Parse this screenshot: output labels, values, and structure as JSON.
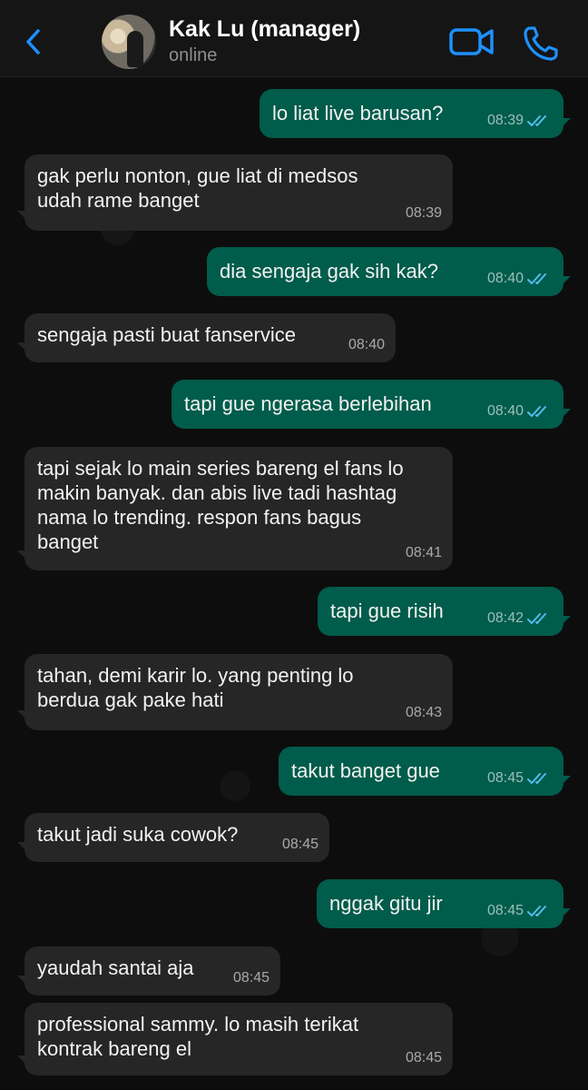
{
  "header": {
    "contact_name": "Kak Lu (manager)",
    "status": "online",
    "icons": [
      "chevron-left-icon",
      "video-call-icon",
      "phone-icon"
    ],
    "accent_color": "#1e90ff"
  },
  "messages": [
    {
      "dir": "out",
      "text": "lo liat live barusan?",
      "time": "08:39"
    },
    {
      "dir": "in",
      "text": "gak perlu nonton, gue liat di medsos\nudah rame banget",
      "time": "08:39"
    },
    {
      "dir": "out",
      "text": "dia sengaja gak sih kak?",
      "time": "08:40"
    },
    {
      "dir": "in",
      "text": "sengaja pasti buat fanservice",
      "time": "08:40"
    },
    {
      "dir": "out",
      "text": "tapi gue ngerasa berlebihan",
      "time": "08:40"
    },
    {
      "dir": "in",
      "text": "tapi sejak lo main series bareng el fans lo\nmakin banyak. dan abis live tadi hashtag\nnama lo trending. respon fans bagus\nbanget",
      "time": "08:41"
    },
    {
      "dir": "out",
      "text": "tapi gue risih",
      "time": "08:42"
    },
    {
      "dir": "in",
      "text": "tahan, demi karir lo. yang penting lo\nberdua gak pake hati",
      "time": "08:43"
    },
    {
      "dir": "out",
      "text": "takut banget gue",
      "time": "08:45"
    },
    {
      "dir": "in",
      "text": "takut jadi suka cowok?",
      "time": "08:45"
    },
    {
      "dir": "out",
      "text": "nggak gitu jir",
      "time": "08:45"
    },
    {
      "dir": "in",
      "text": "yaudah santai aja",
      "time": "08:45"
    },
    {
      "dir": "in",
      "text": "professional sammy. lo masih terikat\nkontrak bareng el",
      "time": "08:45"
    }
  ],
  "colors": {
    "outgoing": "#005c4b",
    "incoming": "#262626",
    "read_ticks": "#53bdeb"
  }
}
